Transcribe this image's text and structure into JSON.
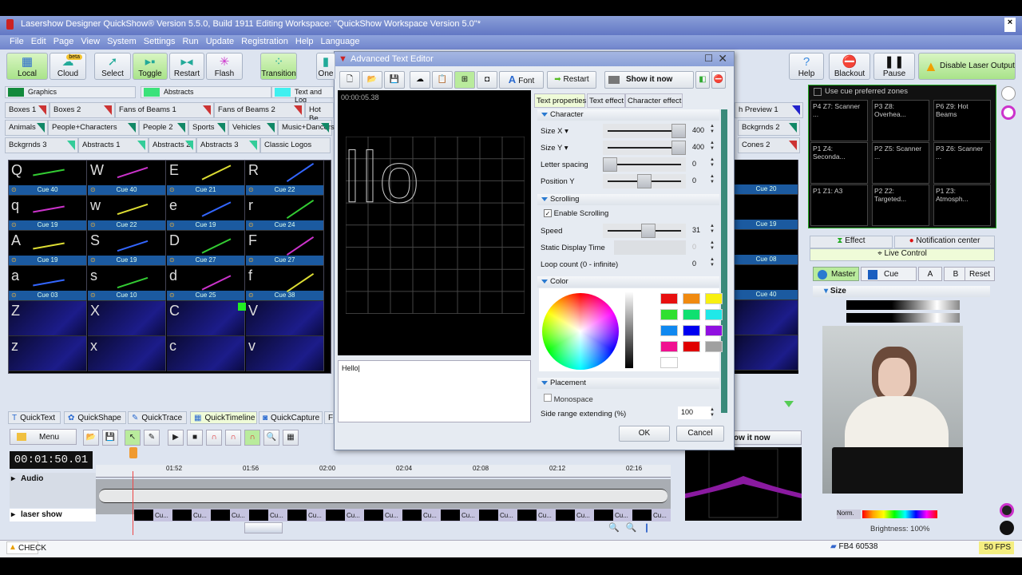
{
  "window": {
    "title": "Lasershow Designer QuickShow®  Version 5.5.0, Build 1911   Editing Workspace: \"QuickShow Workspace Version 5.0\"*"
  },
  "menu": [
    "File",
    "Edit",
    "Page",
    "View",
    "System",
    "Settings",
    "Run",
    "Update",
    "Registration",
    "Help",
    "Language"
  ],
  "toolbar": [
    {
      "label": "Local",
      "icon": "grid-icon"
    },
    {
      "label": "Cloud",
      "icon": "cloud-icon",
      "badge": "beta"
    },
    {
      "label": "Select",
      "icon": "cursor-icon"
    },
    {
      "label": "Toggle",
      "icon": "toggle-icon"
    },
    {
      "label": "Restart",
      "icon": "restart-icon"
    },
    {
      "label": "Flash",
      "icon": "flash-icon"
    },
    {
      "label": "Transition",
      "icon": "transition-icon"
    },
    {
      "label": "One",
      "icon": "one-icon"
    }
  ],
  "right_toolbar": {
    "help": "Help",
    "blackout": "Blackout",
    "pause": "Pause",
    "disable": "Disable Laser Output"
  },
  "categories": [
    "Graphics",
    "Abstracts",
    "Text and Log"
  ],
  "category_colors": [
    "#138a3c",
    "#3be27a",
    "#3ff0f0"
  ],
  "page_tabs": [
    [
      "Boxes 1",
      "Boxes 2",
      "Fans of Beams 1",
      "Fans of Beams 2",
      "Hot Be"
    ],
    [
      "Animals",
      "People+Characters",
      "People 2",
      "Sports",
      "Vehicles",
      "Music+Dancers"
    ],
    [
      "Bckgrnds 3",
      "Abstracts 1",
      "Abstracts 2",
      "Abstracts 3",
      "Classic Logos"
    ]
  ],
  "right_page_tabs": [
    "h Preview 1",
    "Bckgrnds 2",
    "Cones 2"
  ],
  "cues": [
    [
      {
        "k": "Q",
        "c": "Cue 40"
      },
      {
        "k": "W",
        "c": "Cue 40"
      },
      {
        "k": "E",
        "c": "Cue 21"
      },
      {
        "k": "R",
        "c": "Cue 22"
      }
    ],
    [
      {
        "k": "q",
        "c": "Cue 19"
      },
      {
        "k": "w",
        "c": "Cue 22"
      },
      {
        "k": "e",
        "c": "Cue 19"
      },
      {
        "k": "r",
        "c": "Cue 24"
      }
    ],
    [
      {
        "k": "A",
        "c": "Cue 19"
      },
      {
        "k": "S",
        "c": "Cue 19"
      },
      {
        "k": "D",
        "c": "Cue 27"
      },
      {
        "k": "F",
        "c": "Cue 27"
      }
    ],
    [
      {
        "k": "a",
        "c": "Cue 03"
      },
      {
        "k": "s",
        "c": "Cue 10"
      },
      {
        "k": "d",
        "c": "Cue 25"
      },
      {
        "k": "f",
        "c": "Cue 38"
      }
    ],
    [
      {
        "k": "Z",
        "c": ""
      },
      {
        "k": "X",
        "c": ""
      },
      {
        "k": "C",
        "c": ""
      },
      {
        "k": "V",
        "c": ""
      }
    ],
    [
      {
        "k": "z",
        "c": ""
      },
      {
        "k": "x",
        "c": ""
      },
      {
        "k": "c",
        "c": ""
      },
      {
        "k": "v",
        "c": ""
      }
    ]
  ],
  "right_cues": [
    "Cue 20",
    "Cue 19",
    "Cue 08",
    "Cue 40"
  ],
  "editor": {
    "title": "Advanced Text Editor",
    "font": "Font",
    "restart": "Restart",
    "show": "Show it now",
    "timecode": "00:00:05.38",
    "preview_text": "llo",
    "text_value": "Hello",
    "tabs": [
      "Text properties",
      "Text effect",
      "Character effect"
    ],
    "character": {
      "title": "Character",
      "size_x": {
        "label": "Size X ▾",
        "value": "400",
        "pct": 100
      },
      "size_y": {
        "label": "Size Y ▾",
        "value": "400",
        "pct": 100
      },
      "letter_spacing": {
        "label": "Letter spacing",
        "value": "0",
        "pct": 0
      },
      "position_y": {
        "label": "Position Y",
        "value": "0",
        "pct": 50
      }
    },
    "scrolling": {
      "title": "Scrolling",
      "enable": "Enable Scrolling",
      "speed": {
        "label": "Speed",
        "value": "31",
        "pct": 55
      },
      "static": {
        "label": "Static Display Time",
        "value": "0"
      },
      "loop": {
        "label": "Loop count (0 - infinite)",
        "value": "0"
      }
    },
    "color": {
      "title": "Color",
      "swatches": [
        "#e81010",
        "#f08a10",
        "#f8f010",
        "#30e030",
        "#10e070",
        "#20e8e8",
        "#1088f0",
        "#0000f0",
        "#9010e0",
        "#f01090",
        "#e00000",
        "#a0a0a0",
        "#ffffff"
      ]
    },
    "placement": {
      "title": "Placement",
      "monospace": "Monospace",
      "side_range": "Side range extending (%)",
      "side_value": "100"
    },
    "ok": "OK",
    "cancel": "Cancel"
  },
  "bottom_tabs": [
    "QuickText",
    "QuickShape",
    "QuickTrace",
    "QuickTimeline",
    "QuickCapture",
    "F"
  ],
  "timeline": {
    "menu": "Menu",
    "time": "00:01:50.01",
    "ticks": [
      "01:52",
      "01:56",
      "02:00",
      "02:04",
      "02:08",
      "02:12",
      "02:16"
    ],
    "tracks": [
      "Audio",
      "laser show"
    ],
    "clip": "Cu..."
  },
  "zones": {
    "header": "Use cue preferred zones",
    "cells": [
      "P4 Z7: Scanner ...",
      "P3 Z8: Overhea...",
      "P6 Z9: Hot Beams",
      "P1 Z4: Seconda...",
      "P2 Z5: Scanner ...",
      "P3 Z6: Scanner ...",
      "P1 Z1: A3",
      "P2 Z2: Targeted...",
      "P1 Z3: Atmosph..."
    ]
  },
  "live": {
    "effect": "Effect",
    "notification": "Notification center",
    "live_control": "Live Control",
    "master": "Master",
    "cue": "Cue",
    "a": "A",
    "b": "B",
    "reset": "Reset",
    "size": "Size",
    "norm": "Norm.",
    "brightness": "Brightness: 100%"
  },
  "preview_show": "ow it now",
  "status": {
    "check": "CHECK",
    "fb": "FB4 60538",
    "fps": "50 FPS"
  }
}
